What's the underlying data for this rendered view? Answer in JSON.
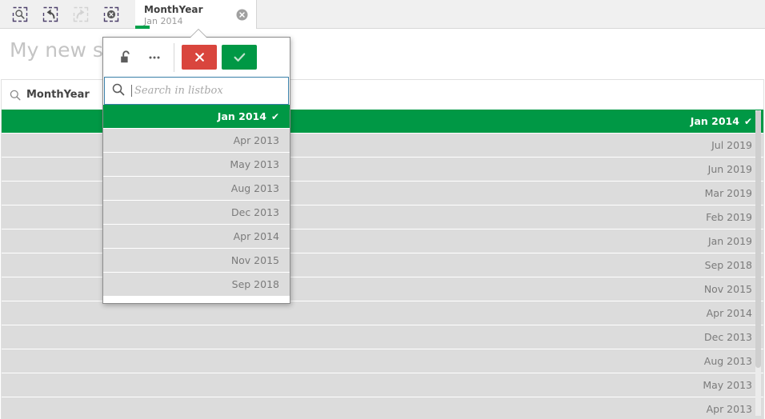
{
  "toolbar": {
    "buttons": [
      {
        "name": "selection-tool-icon",
        "label": "Selection tool",
        "enabled": true
      },
      {
        "name": "step-back-icon",
        "label": "Step back",
        "enabled": true
      },
      {
        "name": "step-forward-icon",
        "label": "Step forward",
        "enabled": false
      },
      {
        "name": "clear-selections-icon",
        "label": "Clear all selections",
        "enabled": true
      }
    ]
  },
  "selection_chip": {
    "field": "MonthYear",
    "value": "Jan 2014",
    "close_icon": "close-circle-icon",
    "state_color": "#00a14b"
  },
  "sheet": {
    "title": "My new sheet"
  },
  "listbox": {
    "title": "MonthYear",
    "search_icon": "search-icon",
    "rows": [
      {
        "label": "Jan 2014",
        "selected": true
      },
      {
        "label": "Jul 2019",
        "selected": false
      },
      {
        "label": "Jun 2019",
        "selected": false
      },
      {
        "label": "Mar 2019",
        "selected": false
      },
      {
        "label": "Feb 2019",
        "selected": false
      },
      {
        "label": "Jan 2019",
        "selected": false
      },
      {
        "label": "Sep 2018",
        "selected": false
      },
      {
        "label": "Nov 2015",
        "selected": false
      },
      {
        "label": "Apr 2014",
        "selected": false
      },
      {
        "label": "Dec 2013",
        "selected": false
      },
      {
        "label": "Aug 2013",
        "selected": false
      },
      {
        "label": "May 2013",
        "selected": false
      },
      {
        "label": "Apr 2013",
        "selected": false
      }
    ]
  },
  "popover": {
    "lock_icon": "unlock-icon",
    "more_icon": "more-options-icon",
    "cancel_icon": "close-icon",
    "confirm_icon": "check-icon",
    "cancel_color": "#d9453d",
    "confirm_color": "#009845",
    "search": {
      "icon": "search-icon",
      "value": "",
      "placeholder": "Search in listbox"
    },
    "rows": [
      {
        "label": "Jan 2014",
        "selected": true
      },
      {
        "label": "Apr 2013",
        "selected": false
      },
      {
        "label": "May 2013",
        "selected": false
      },
      {
        "label": "Aug 2013",
        "selected": false
      },
      {
        "label": "Dec 2013",
        "selected": false
      },
      {
        "label": "Apr 2014",
        "selected": false
      },
      {
        "label": "Nov 2015",
        "selected": false
      },
      {
        "label": "Sep 2018",
        "selected": false
      }
    ],
    "check_glyph": "✔"
  }
}
